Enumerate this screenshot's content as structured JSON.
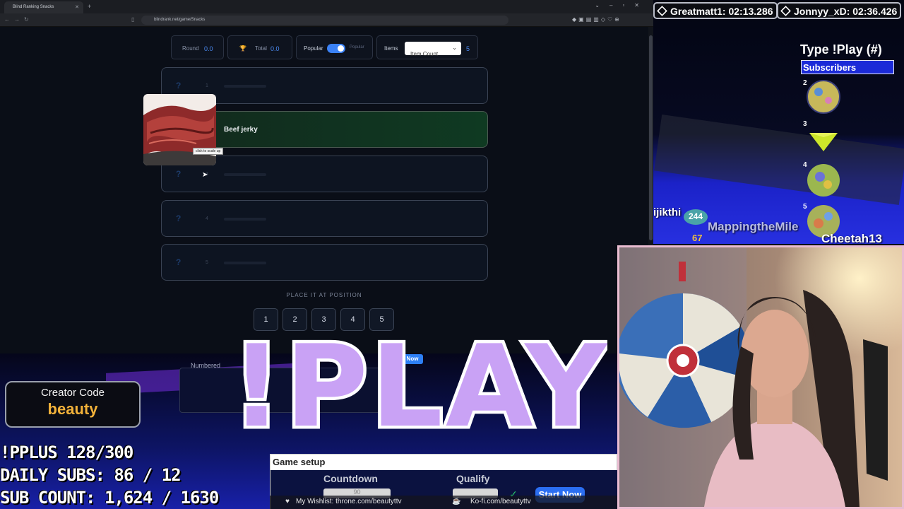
{
  "browser": {
    "tab_title": "Blind Ranking Snacks",
    "url": "blindrank.net/game/Snacks"
  },
  "controls": {
    "round_label": "Round",
    "round_value": "0.0",
    "total_label": "Total",
    "total_value": "0.0",
    "popular_label": "Popular",
    "popular_toggle_label": "Popular",
    "popular_on": true,
    "items_label": "Items",
    "items_select": "Item Count",
    "items_value": "5"
  },
  "slots": [
    {
      "num": "1",
      "filled": false
    },
    {
      "num": "",
      "filled": true,
      "label": "Beef jerky"
    },
    {
      "num": "3",
      "filled": false
    },
    {
      "num": "4",
      "filled": false
    },
    {
      "num": "5",
      "filled": false
    }
  ],
  "tooltip": "click to scale up",
  "place_title": "PLACE IT AT POSITION",
  "positions": [
    "1",
    "2",
    "3",
    "4",
    "5"
  ],
  "overlay": {
    "play_text": "!PLAY",
    "now_label": "Now",
    "ghost_text": "Numbered",
    "creator_title": "Creator Code",
    "creator_code": "beauty",
    "stats": [
      "!PPLUS 128/300",
      "DAILY SUBS: 86 / 12",
      "SUB COUNT: 1,624 / 1630"
    ],
    "setup_title": "Game setup",
    "countdown_label": "Countdown",
    "countdown_value": "90",
    "qualify_label": "Qualify",
    "start_label": "Start Now",
    "wishlist": "My Wishlist: throne.com/beautyttv",
    "kofi": "Ko-fi.com/beautyttv"
  },
  "leaderboard": [
    {
      "name": "Greatmatt1",
      "time": "02:13.286"
    },
    {
      "name": "Jonnyy_xD",
      "time": "02:36.426"
    }
  ],
  "right_panel": {
    "type_play": "Type !Play (#)",
    "subs_header": "Subscribers",
    "ranks": [
      "2",
      "3",
      "4",
      "5"
    ],
    "chat_names": [
      "ijikthi",
      "MappingtheMile",
      "Cheetah13"
    ],
    "bubble_counts": [
      "244",
      "67"
    ]
  },
  "colors": {
    "accent": "#3b82f6",
    "play_purple": "#c9a2f5",
    "creator_code": "#f3b23a"
  }
}
